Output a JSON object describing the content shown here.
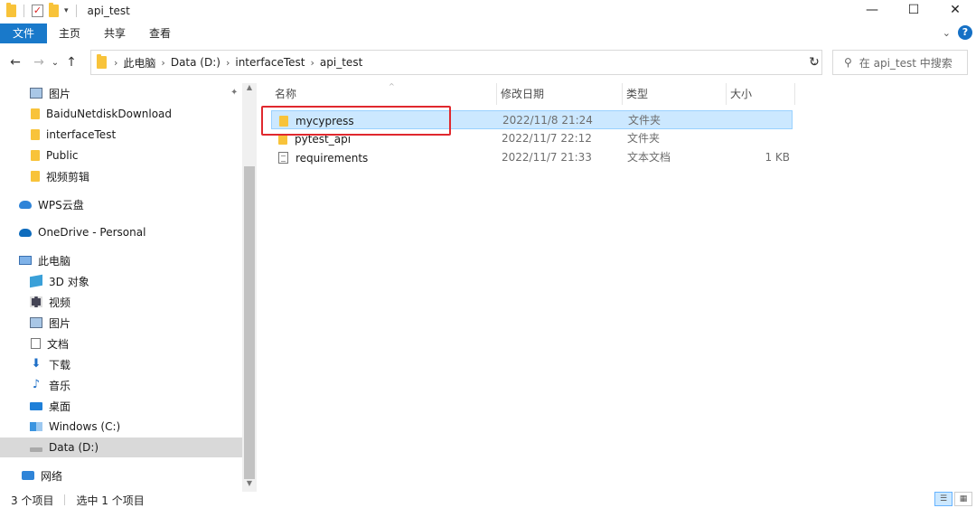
{
  "window": {
    "title": "api_test",
    "controls": {
      "minimize": "—",
      "maximize": "☐",
      "close": "✕"
    }
  },
  "ribbon": {
    "tabs": [
      "文件",
      "主页",
      "共享",
      "查看"
    ]
  },
  "address": {
    "crumbs": [
      "此电脑",
      "Data (D:)",
      "interfaceTest",
      "api_test"
    ],
    "search_placeholder": "在 api_test 中搜索"
  },
  "sidebar": {
    "quick_access": [
      "图片",
      "BaiduNetdiskDownload",
      "interfaceTest",
      "Public",
      "视频剪辑"
    ],
    "wps": "WPS云盘",
    "onedrive": "OneDrive - Personal",
    "this_pc": "此电脑",
    "pc_items": [
      "3D 对象",
      "视频",
      "图片",
      "文档",
      "下载",
      "音乐",
      "桌面",
      "Windows (C:)",
      "Data (D:)"
    ],
    "network": "网络",
    "selected_item": "Data (D:)"
  },
  "columns": {
    "name": "名称",
    "date": "修改日期",
    "type": "类型",
    "size": "大小"
  },
  "files": [
    {
      "name": "mycypress",
      "date": "2022/11/8 21:24",
      "type": "文件夹",
      "size": "",
      "kind": "folder",
      "selected": true
    },
    {
      "name": "pytest_api",
      "date": "2022/11/7 22:12",
      "type": "文件夹",
      "size": "",
      "kind": "folder",
      "selected": false
    },
    {
      "name": "requirements",
      "date": "2022/11/7 21:33",
      "type": "文本文档",
      "size": "1 KB",
      "kind": "file",
      "selected": false
    }
  ],
  "status": {
    "count": "3 个项目",
    "selected": "选中 1 个项目"
  },
  "colors": {
    "file_tab": "#1979ca",
    "selection": "#cce8ff",
    "highlight_box": "#e0282e",
    "folder": "#f8c33a"
  }
}
